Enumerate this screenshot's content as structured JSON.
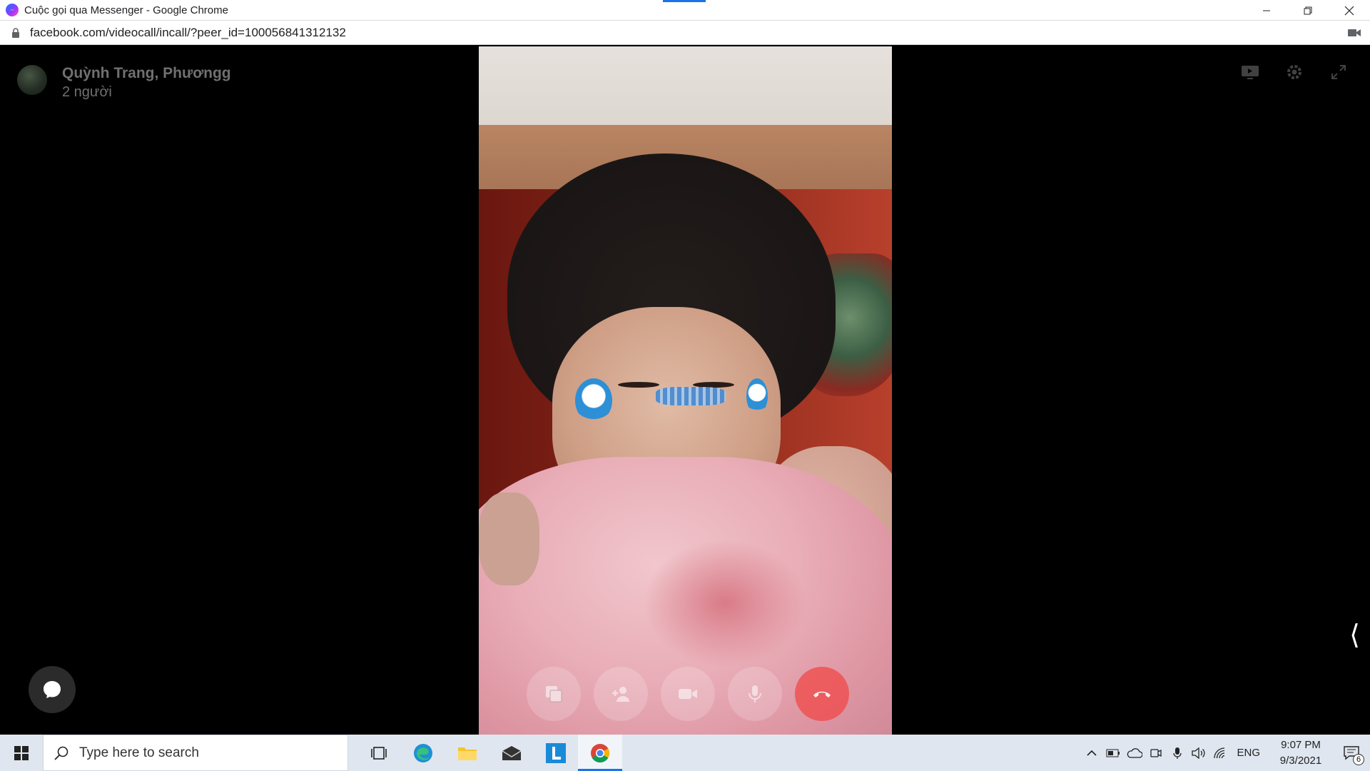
{
  "window": {
    "title": "Cuộc gọi qua Messenger - Google Chrome",
    "controls": {
      "minimize": "minimize-icon",
      "restore": "restore-icon",
      "close": "close-icon"
    }
  },
  "address_bar": {
    "url": "facebook.com/videocall/incall/?peer_id=100056841312132"
  },
  "call": {
    "title": "Quỳnh Trang, Phươngg",
    "participants": "2 người",
    "top_controls": [
      "screen-share-icon",
      "settings-icon",
      "fullscreen-icon"
    ],
    "bottom_controls": [
      "share-screen-icon",
      "add-person-icon",
      "camera-icon",
      "microphone-icon",
      "end-call-icon"
    ],
    "side_toggle": "⟨"
  },
  "taskbar": {
    "search_placeholder": "Type here to search",
    "apps": [
      "task-view-icon",
      "edge-icon",
      "file-explorer-icon",
      "mail-icon",
      "l-app-icon",
      "chrome-icon"
    ],
    "language": "ENG",
    "time": "9:07 PM",
    "date": "9/3/2021",
    "notification_count": "6"
  },
  "colors": {
    "accent": "#1a73e8",
    "end_call": "#f04848",
    "taskbar": "#dfe6ef"
  }
}
